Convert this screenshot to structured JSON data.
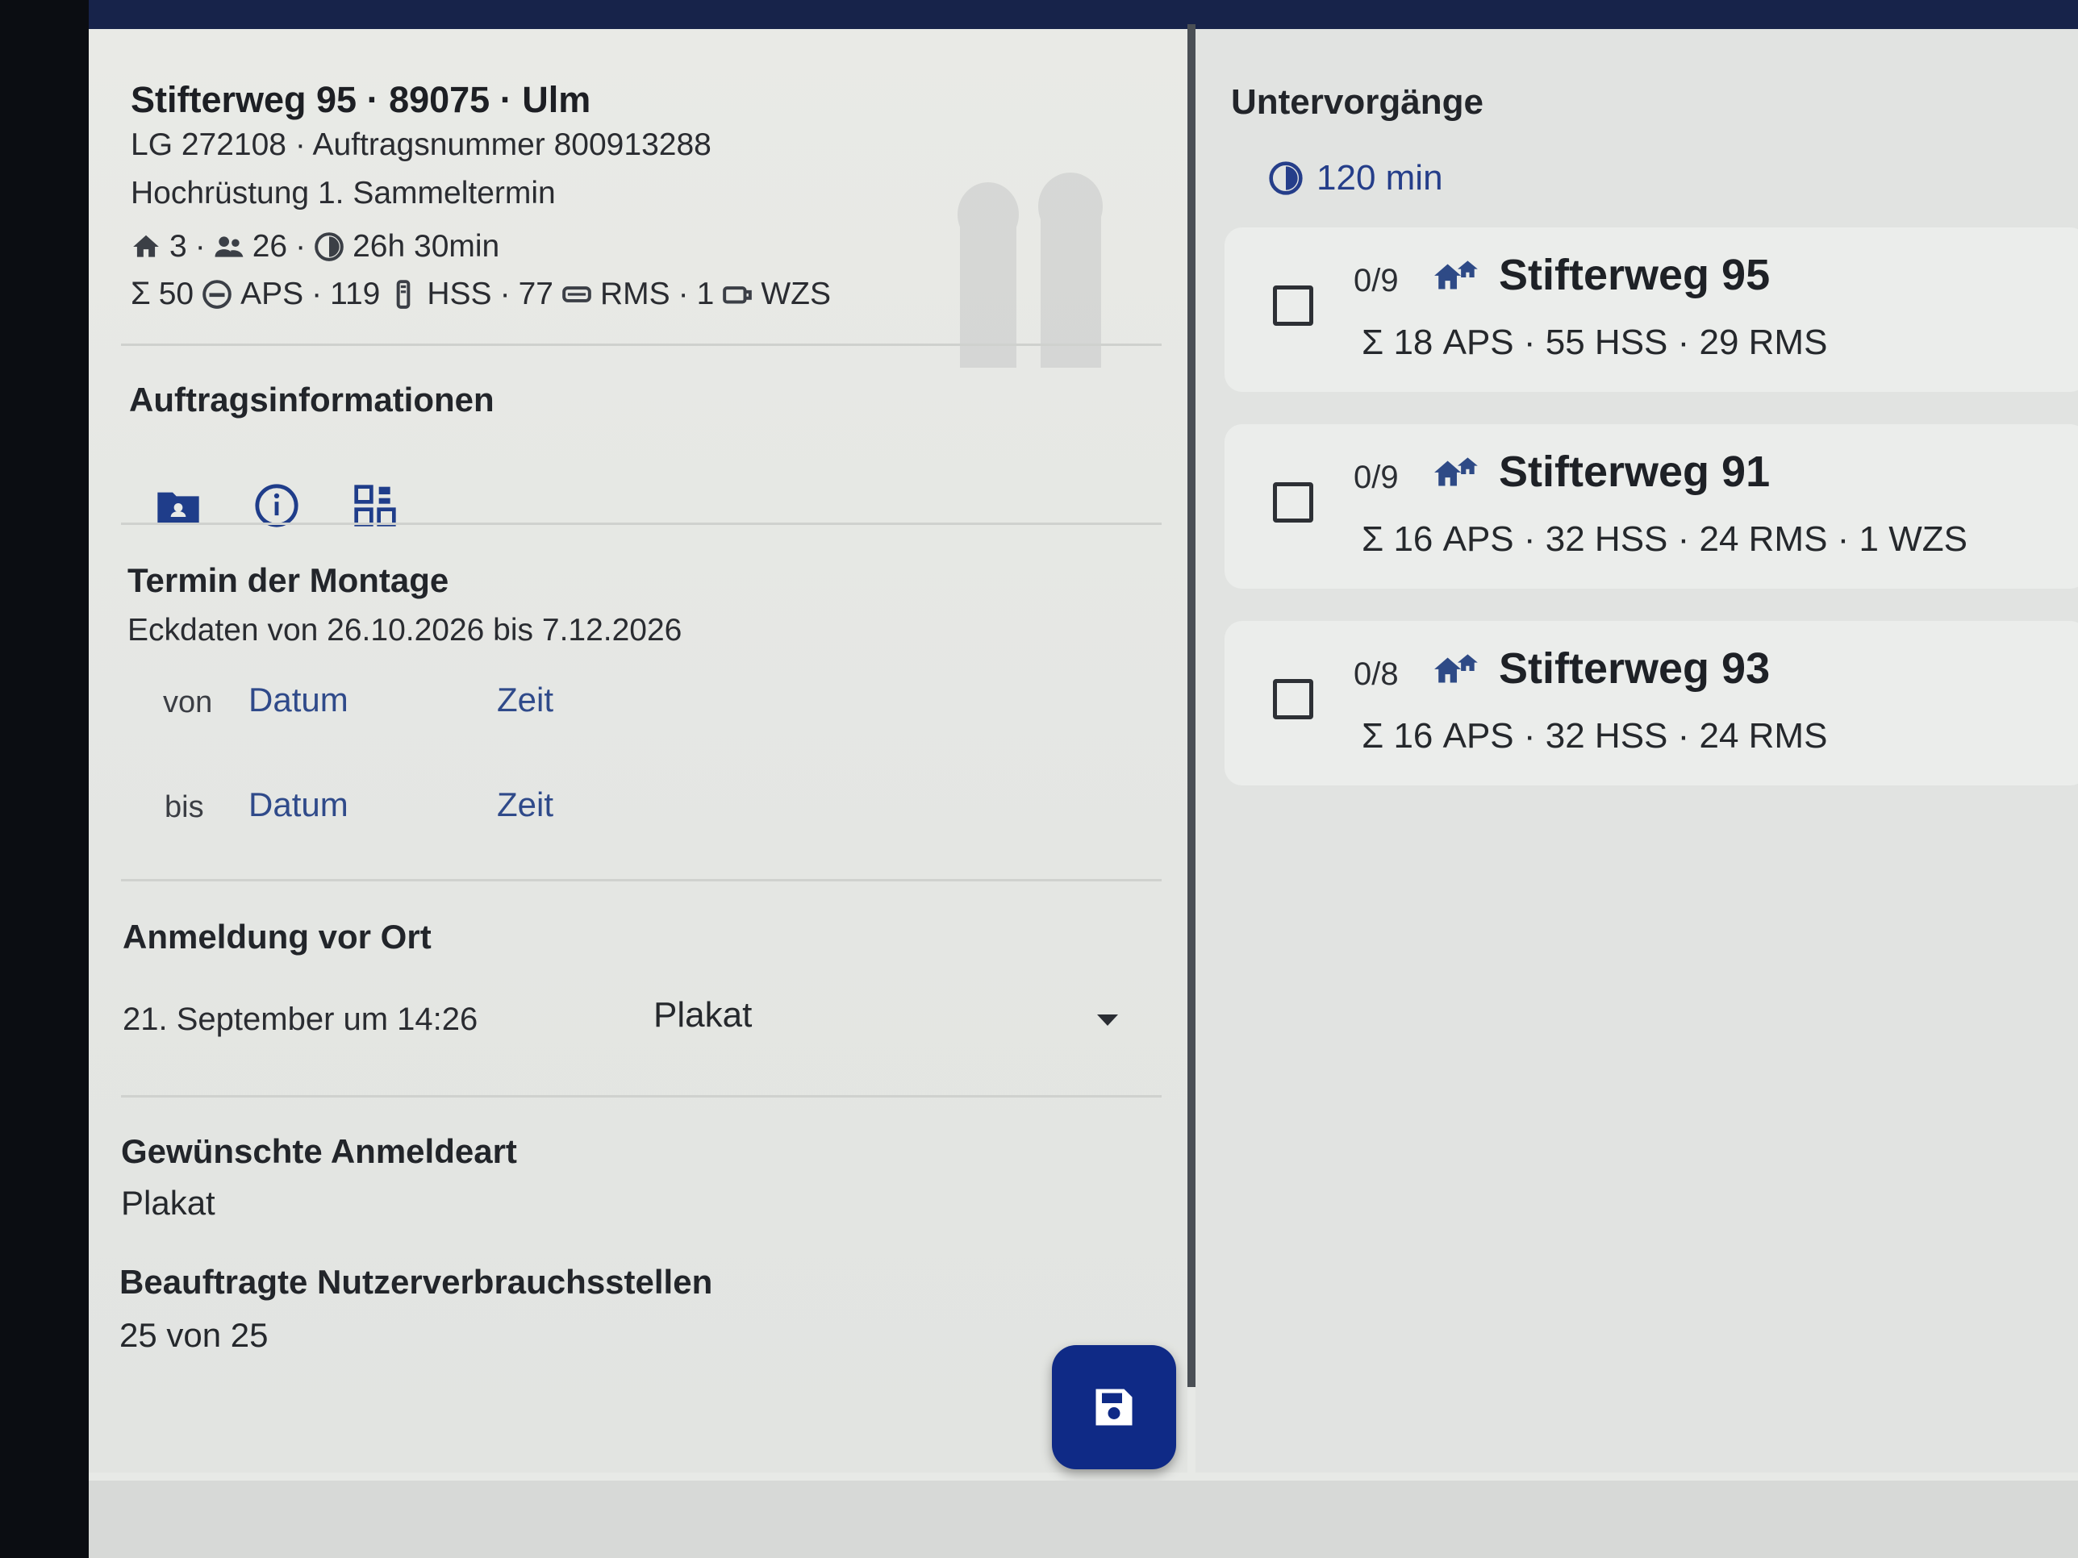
{
  "header": {
    "address": "Stifterweg 95 · 89075 · Ulm",
    "reference": "LG 272108 · Auftragsnummer 800913288",
    "description": "Hochrüstung 1. Sammeltermin"
  },
  "stats": {
    "houses": "3",
    "persons": "26",
    "duration": "26h 30min",
    "sum": "50",
    "aps_label": "APS",
    "aps_count": "119",
    "hss_label": "HSS",
    "hss_count": "77",
    "rms_label": "RMS",
    "rms_count": "1",
    "wzs_label": "WZS",
    "sep": "·"
  },
  "sections": {
    "order_info": "Auftragsinformationen",
    "appointment": "Termin der Montage",
    "key_dates": "Eckdaten von 26.10.2026 bis 7.12.2026",
    "from_label": "von",
    "to_label": "bis",
    "date_placeholder": "Datum",
    "time_placeholder": "Zeit",
    "registration": "Anmeldung vor Ort",
    "registration_date": "21. September um 14:26",
    "registration_method": "Plakat",
    "desired_method_title": "Gewünschte Anmeldeart",
    "desired_method_value": "Plakat",
    "consumers_title": "Beauftragte Nutzerverbrauchsstellen",
    "consumers_value": "25 von 25"
  },
  "right_panel": {
    "title": "Untervorgänge",
    "duration": "120 min",
    "items": [
      {
        "count": "0/9",
        "title": "Stifterweg 95",
        "summary": "18 APS · 55 HSS · 29 RMS"
      },
      {
        "count": "0/9",
        "title": "Stifterweg 91",
        "summary": "16 APS · 32 HSS · 24 RMS · 1 WZS"
      },
      {
        "count": "0/8",
        "title": "Stifterweg 93",
        "summary": "16 APS · 32 HSS · 24 RMS"
      }
    ]
  },
  "icons": {
    "info_bar": [
      "folder-icon",
      "info-icon",
      "qr-code-icon"
    ],
    "fab": "save-icon"
  },
  "colors": {
    "accent": "#0f2a86",
    "link": "#2f4a8a",
    "topbar": "#17234a"
  }
}
